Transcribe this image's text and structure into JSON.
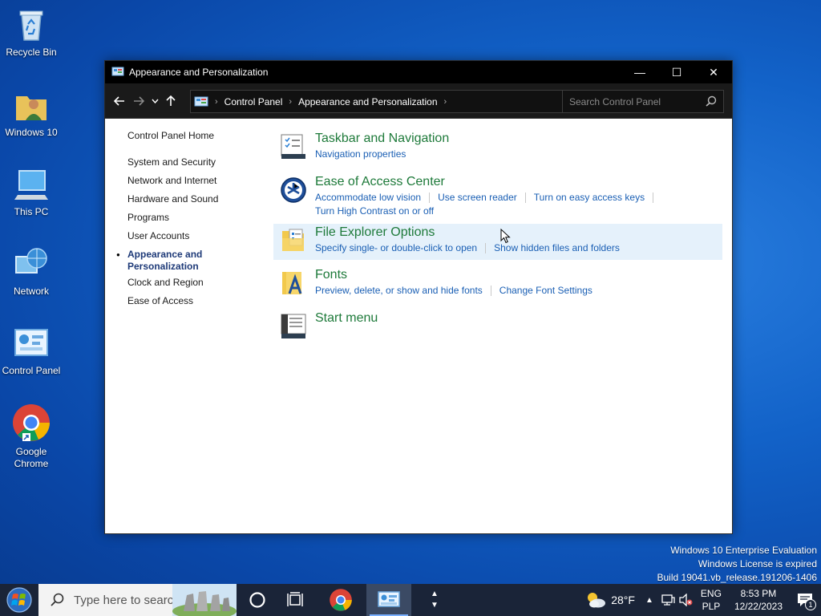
{
  "desktop": {
    "icons": [
      {
        "label": "Recycle Bin"
      },
      {
        "label": "Windows 10"
      },
      {
        "label": "This PC"
      },
      {
        "label": "Network"
      },
      {
        "label": "Control Panel"
      },
      {
        "label": "Google Chrome"
      }
    ]
  },
  "window": {
    "title": "Appearance and Personalization",
    "controls": {
      "minimize": "—",
      "maximize": "☐",
      "close": "✕"
    },
    "address": {
      "crumbs": [
        "Control Panel",
        "Appearance and Personalization"
      ]
    },
    "search": {
      "placeholder": "Search Control Panel"
    }
  },
  "left_pane": {
    "home": "Control Panel Home",
    "items": [
      "System and Security",
      "Network and Internet",
      "Hardware and Sound",
      "Programs",
      "User Accounts",
      "Appearance and Personalization",
      "Clock and Region",
      "Ease of Access"
    ],
    "active_index": 5
  },
  "categories": [
    {
      "title": "Taskbar and Navigation",
      "icon": "taskbar-icon",
      "links": [
        "Navigation properties"
      ]
    },
    {
      "title": "Ease of Access Center",
      "icon": "ease-of-access-icon",
      "links": [
        "Accommodate low vision",
        "Use screen reader",
        "Turn on easy access keys",
        "Turn High Contrast on or off"
      ]
    },
    {
      "title": "File Explorer Options",
      "icon": "folder-options-icon",
      "links": [
        "Specify single- or double-click to open",
        "Show hidden files and folders"
      ]
    },
    {
      "title": "Fonts",
      "icon": "fonts-icon",
      "links": [
        "Preview, delete, or show and hide fonts",
        "Change Font Settings"
      ]
    },
    {
      "title": "Start menu",
      "icon": "start-menu-icon",
      "links": []
    }
  ],
  "watermark": {
    "line1": "Windows 10 Enterprise Evaluation",
    "line2": "Windows License is expired",
    "line3": "Build 19041.vb_release.191206-1406"
  },
  "taskbar": {
    "search_placeholder": "Type here to search",
    "weather": "28°F",
    "lang_top": "ENG",
    "lang_bottom": "PLP",
    "time": "8:53 PM",
    "date": "12/22/2023",
    "notification_count": "1"
  },
  "colors": {
    "category_title": "#1e7a3a",
    "link": "#1a5fb4",
    "titlebar": "#000000",
    "taskbar": "#1a2438"
  }
}
